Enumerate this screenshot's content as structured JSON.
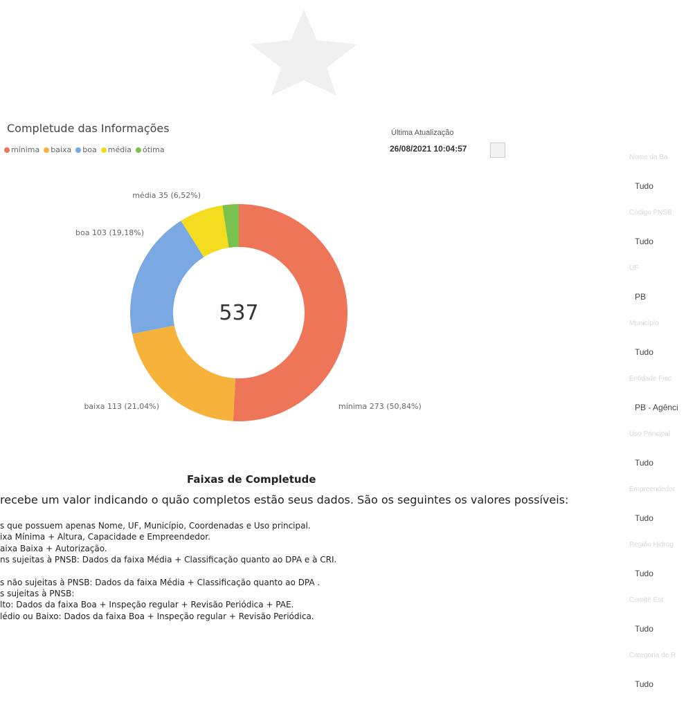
{
  "header": {
    "title": "Completude das Informações",
    "last_update_label": "Última Atualização",
    "last_update_value": "26/08/2021 10:04:57"
  },
  "legend": [
    {
      "label": "mínima",
      "color": "#ef7559"
    },
    {
      "label": "baixa",
      "color": "#f7b23c"
    },
    {
      "label": "boa",
      "color": "#7aa8e2"
    },
    {
      "label": "média",
      "color": "#f4dc1e"
    },
    {
      "label": "ótima",
      "color": "#7ac24d"
    }
  ],
  "chart_data": {
    "type": "pie",
    "total_label": "537",
    "slices": [
      {
        "name": "mínima",
        "value": 273,
        "pct": "50,84%",
        "label": "mínima 273 (50,84%)",
        "color": "#ef7559"
      },
      {
        "name": "baixa",
        "value": 113,
        "pct": "21,04%",
        "label": "baixa 113 (21,04%)",
        "color": "#f7b23c"
      },
      {
        "name": "boa",
        "value": 103,
        "pct": "19,18%",
        "label": "boa 103 (19,18%)",
        "color": "#7aa8e2"
      },
      {
        "name": "média",
        "value": 35,
        "pct": "6,52%",
        "label": "média 35 (6,52%)",
        "color": "#f4dc1e"
      },
      {
        "name": "ótima",
        "value": 13,
        "pct": "",
        "label": "",
        "color": "#7ac24d"
      }
    ]
  },
  "faixas": {
    "title": "Faixas de Completude",
    "intro": "recebe um valor indicando o quão completos estão seus dados. São os seguintes os valores possíveis:",
    "lines": [
      "s que possuem apenas Nome, UF, Município, Coordenadas e Uso principal.",
      "ixa Mínima + Altura, Capacidade e Empreendedor.",
      "aixa Baixa + Autorização.",
      "ns sujeitas à PNSB: Dados da faixa Média + Classificação quanto ao DPA e à CRI."
    ],
    "lines2": [
      "s não sujeitas à PNSB: Dados da faixa Média + Classificação quanto ao DPA .",
      "s sujeitas à PNSB:",
      "lto: Dados da faixa Boa + Inspeção regular + Revisão Periódica + PAE.",
      "lédio ou Baixo: Dados da faixa Boa + Inspeção regular + Revisão Periódica."
    ]
  },
  "filters": [
    {
      "label": "Nome da Ba",
      "value": "Tudo"
    },
    {
      "label": "Código PNSB",
      "value": "Tudo"
    },
    {
      "label": "UF",
      "value": "PB"
    },
    {
      "label": "Município",
      "value": "Tudo"
    },
    {
      "label": "Entidade Fisc",
      "value": "PB - Agênci"
    },
    {
      "label": "Uso Principal",
      "value": "Tudo"
    },
    {
      "label": "Empreendedor",
      "value": "Tudo"
    },
    {
      "label": "Região Hidrog",
      "value": "Tudo"
    },
    {
      "label": "Comitê Est",
      "value": "Tudo"
    },
    {
      "label": "Categoria de R",
      "value": "Tudo"
    }
  ]
}
